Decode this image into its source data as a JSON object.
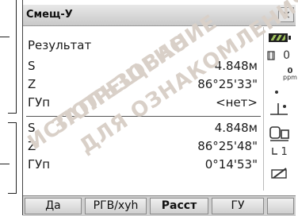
{
  "window": {
    "title": "Смещ-У",
    "close_label": "×"
  },
  "results": {
    "header": "Результат",
    "rows1": [
      {
        "label": "S",
        "value": "4.848м"
      },
      {
        "label": "Z",
        "value": "86°25'33\""
      },
      {
        "label": "ГУп",
        "value": "<нет>"
      }
    ],
    "rows2": [
      {
        "label": "S",
        "value": "4.848м"
      },
      {
        "label": "Z",
        "value": "86°25'48\""
      },
      {
        "label": "ГУп",
        "value": "0°14'53\""
      }
    ]
  },
  "status": {
    "target_const": "0",
    "ppm_value": "0",
    "ppm_label": "ppm",
    "flag_value": "1"
  },
  "softkeys": [
    "Да",
    "РГВ/xyh",
    "Расст",
    "ГУ",
    ""
  ],
  "watermark": [
    "ИСПОЛЬЗОВАНИЕ",
    "ЗАПРЕЩЕНО!",
    "ДЛЯ ОЗНАКОМЛЕНИЯ"
  ]
}
